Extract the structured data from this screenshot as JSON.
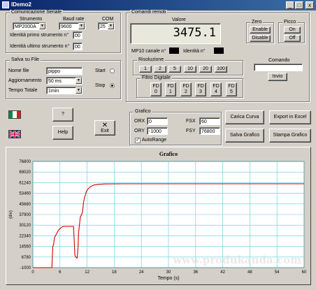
{
  "window": {
    "title": "IDemo2",
    "min": "_",
    "max": "□",
    "close": "x"
  },
  "comm": {
    "title": "Comunicazione Seriale",
    "strumento_label": "Strumento",
    "strumento_value": "MP2000A",
    "baud_label": "Baud rate",
    "baud_value": "9600",
    "com_label": "COM",
    "com_value": "25",
    "id_first_label": "Identità primo strumento n°",
    "id_first_value": "00",
    "id_last_label": "Identità ultimo strumento n°",
    "id_last_value": "00"
  },
  "remote": {
    "title": "Comandi remoti",
    "valore_label": "Valore",
    "valore": "3475.1",
    "mp10_label": "MP10 canale n°",
    "identita_label": "Identità n°",
    "zero_title": "Zero",
    "enable": "Enable",
    "disable": "Disable",
    "picco_title": "Picco",
    "on": "On",
    "off": "Off",
    "risoluzione_title": "Risoluzione",
    "risoluzione": [
      "1",
      "2",
      "5",
      "10",
      "20",
      "100"
    ],
    "filtro_title": "Filtro Digitale",
    "filtro": [
      [
        "FD",
        "0"
      ],
      [
        "FD",
        "1"
      ],
      [
        "FD",
        "2"
      ],
      [
        "FD",
        "3"
      ],
      [
        "FD",
        "4"
      ],
      [
        "FD",
        "5"
      ]
    ],
    "comando_label": "Comando",
    "comando_value": "",
    "invio": "Invio"
  },
  "save": {
    "title": "Salva su File",
    "nome_label": "Nome file",
    "nome_value": "pippo",
    "agg_label": "Aggiornamento",
    "agg_value": "50 ms",
    "tempo_label": "Tempo Totale",
    "tempo_value": "1min",
    "start": "Start",
    "stop": "Stop"
  },
  "side": {
    "q": "?",
    "help": "Help",
    "exit": "Exit"
  },
  "grafico": {
    "title": "Grafico",
    "orx_label": "ORX",
    "orx": "0",
    "fsx_label": "FSX",
    "fsx": "60",
    "ory_label": "ORY",
    "ory": "-1000",
    "fsy_label": "FSY",
    "fsy": "76800",
    "autorange": "AutoRange"
  },
  "actions": {
    "carica": "Carica Curva",
    "export": "Export in Excel",
    "salva": "Salva Grafico",
    "stampa": "Stampa Grafico"
  },
  "colors": {
    "plot_line": "#cc0000",
    "grid": "#60c8d8",
    "plot_bg": "#ffffff"
  },
  "chart_data": {
    "type": "line",
    "title": "Grafico",
    "xlabel": "Tempo (s)",
    "ylabel": "(div)",
    "xlim": [
      0,
      60
    ],
    "ylim": [
      -1000,
      76800
    ],
    "xticks": [
      "0",
      "6",
      "12",
      "18",
      "24",
      "30",
      "36",
      "42",
      "48",
      "54",
      "60"
    ],
    "yticks": [
      "-1000",
      "6780",
      "14560",
      "22340",
      "30120",
      "37900",
      "45680",
      "53460",
      "61240",
      "69020",
      "76800"
    ],
    "grid": true,
    "watermark": "www.produkanda.com",
    "series": [
      {
        "x": [
          0,
          4.2,
          4.4,
          4.6,
          4.8,
          5.0,
          5.2,
          5.5,
          5.8,
          6.0,
          6.3,
          6.6,
          7.0,
          8.0,
          9.0,
          9.2,
          9.3,
          9.5,
          9.8,
          10.0,
          10.1,
          10.3,
          10.5,
          10.8,
          11.0,
          11.2,
          11.4,
          11.6,
          11.8,
          12.0,
          12.3,
          12.8,
          13.5,
          14.5,
          16,
          20,
          60
        ],
        "y": [
          -1000,
          -1000,
          14560,
          16000,
          21000,
          22340,
          23500,
          25500,
          27000,
          27500,
          28500,
          29000,
          29200,
          29200,
          29200,
          14560,
          8000,
          6780,
          6000,
          14000,
          24000,
          30120,
          36000,
          38000,
          40000,
          46500,
          50000,
          52000,
          54500,
          55500,
          57000,
          58500,
          59500,
          60000,
          60300,
          60400,
          60400
        ]
      }
    ]
  }
}
